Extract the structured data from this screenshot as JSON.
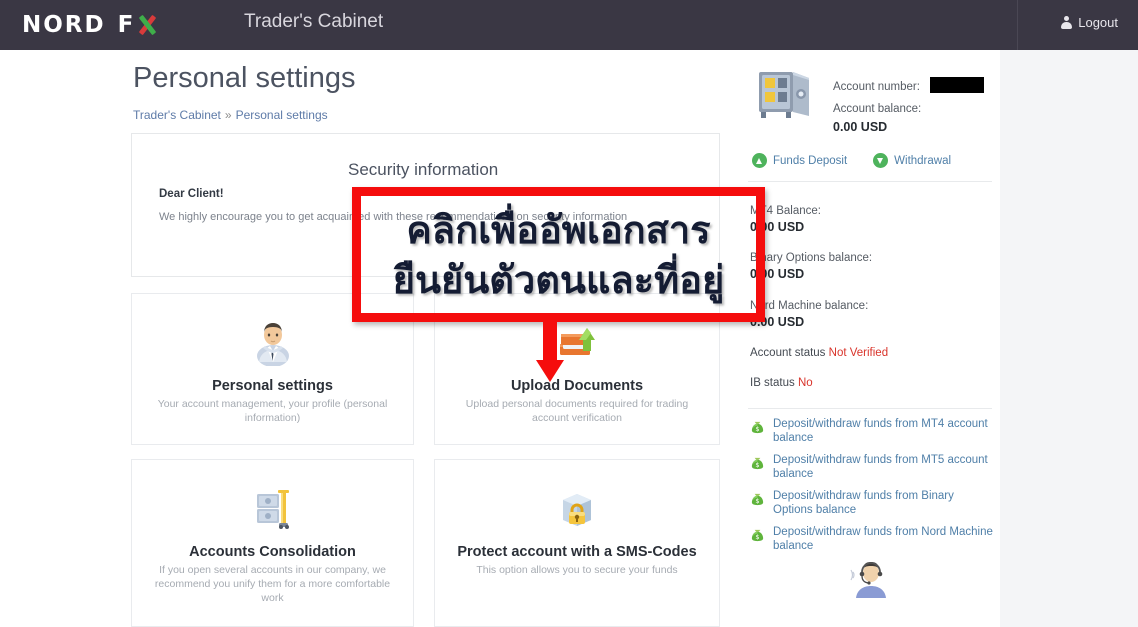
{
  "topbar": {
    "logo_nord": "NORD",
    "logo_f": "F",
    "logo_x_icon": "x-mark-icon",
    "cabinet_title": "Trader's Cabinet",
    "logout_label": "Logout",
    "logout_icon": "user-icon"
  },
  "header": {
    "page_title": "Personal settings",
    "breadcrumb_root": "Trader's Cabinet",
    "breadcrumb_sep": "»",
    "breadcrumb_current": "Personal settings"
  },
  "security": {
    "heading": "Security information",
    "salutation": "Dear Client!",
    "body": "We highly encourage you to get acquainted with these recommendations on security information"
  },
  "cards": [
    {
      "id": "personal",
      "icon": "businessman-avatar-icon",
      "title": "Personal settings",
      "desc": "Your account management, your profile (personal information)"
    },
    {
      "id": "upload",
      "icon": "upload-documents-icon",
      "title": "Upload Documents",
      "desc": "Upload personal documents required for trading account verification"
    },
    {
      "id": "consolidation",
      "icon": "safe-stack-icon",
      "title": "Accounts Consolidation",
      "desc": "If you open several accounts in our company, we recommend you unify them for a more comfortable work"
    },
    {
      "id": "sms",
      "icon": "locked-box-icon",
      "title": "Protect account with a SMS-Codes",
      "desc": "This option allows you to secure your funds"
    }
  ],
  "sidebar": {
    "account_icon": "safe-icon",
    "account_number_label": "Account number:",
    "account_number_value": "",
    "account_balance_label": "Account balance:",
    "account_balance_value": "0.00 USD",
    "funds_deposit_label": "Funds Deposit",
    "funds_deposit_icon": "arrow-up-circle-icon",
    "withdrawal_label": "Withdrawal",
    "withdrawal_icon": "arrow-down-circle-icon",
    "balances": [
      {
        "label": "MT4 Balance:",
        "value": "0.00 USD"
      },
      {
        "label": "Binary Options balance:",
        "value": "0.00 USD"
      },
      {
        "label": "Nord Machine balance:",
        "value": "0.00 USD"
      }
    ],
    "account_status_label": "Account status",
    "account_status_value": "Not Verified",
    "ib_status_label": "IB status",
    "ib_status_value": "No",
    "transfer_links": [
      {
        "icon": "money-bag-icon",
        "label": "Deposit/withdraw funds from MT4 account balance"
      },
      {
        "icon": "money-bag-icon",
        "label": "Deposit/withdraw funds from MT5 account balance"
      },
      {
        "icon": "money-bag-icon",
        "label": "Deposit/withdraw funds from Binary Options balance"
      },
      {
        "icon": "money-bag-icon",
        "label": "Deposit/withdraw funds from Nord Machine balance"
      }
    ],
    "support_avatar_icon": "support-agent-icon"
  },
  "annotation": {
    "thai_line_1": "คลิกเพื่ออัพเอกสาร",
    "thai_line_2": "ยืนยันตัวตนและที่อยู่",
    "box_color": "#f50d0d",
    "arrow_icon": "red-down-arrow-icon"
  },
  "colors": {
    "topbar_bg": "#3a3744",
    "page_bg": "#f4f5f7",
    "accent_link": "#4f7fa8",
    "status_red": "#d9342b",
    "green": "#4eb35c"
  }
}
